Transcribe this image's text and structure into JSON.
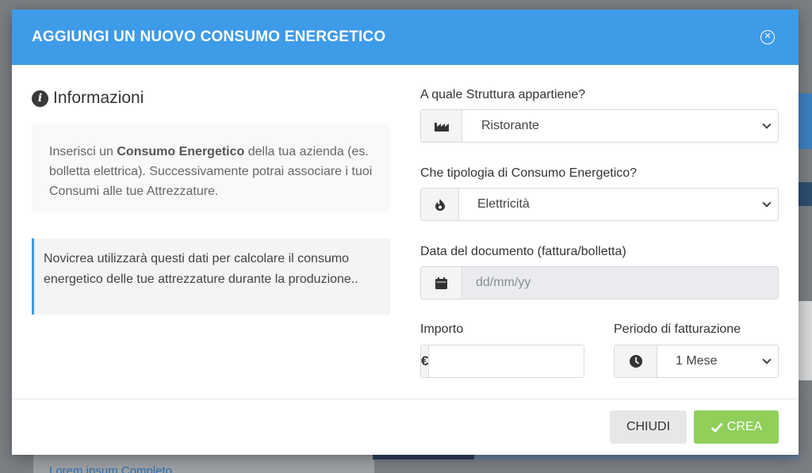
{
  "modal": {
    "title": "AGGIUNGI UN NUOVO CONSUMO ENERGETICO"
  },
  "info": {
    "title": "Informazioni",
    "intro_prefix": "Inserisci un ",
    "intro_bold": "Consumo Energetico",
    "intro_suffix": " della tua azienda (es. bolletta elettrica). Successivamente potrai associare i tuoi Consumi alle tue Attrezzature.",
    "note": "Novicrea utilizzarà questi dati per calcolare il consumo energetico delle tue attrezzature durante la produzione.."
  },
  "form": {
    "structure_label": "A quale Struttura appartiene?",
    "structure_value": "Ristorante",
    "type_label": "Che tipologia di Consumo Energetico?",
    "type_value": "Elettricità",
    "date_label": "Data del documento (fattura/bolletta)",
    "date_placeholder": "dd/mm/yy",
    "amount_label": "Importo",
    "amount_value": "",
    "currency_symbol": "€",
    "period_label": "Periodo di fatturazione",
    "period_value": "1 Mese"
  },
  "footer": {
    "close_label": "CHIUDI",
    "create_label": "CREA"
  },
  "background": {
    "link_text": "Lorem ipsum Completo"
  },
  "colors": {
    "header_bg": "#3e9be8",
    "create_button": "#8fcf5a",
    "close_button": "#e6e7e9"
  },
  "icons": {
    "close": "close-circle-icon",
    "info": "info-circle-icon",
    "structure": "factory-icon",
    "type": "fire-icon",
    "date": "calendar-icon",
    "period": "clock-icon",
    "create": "check-icon"
  }
}
